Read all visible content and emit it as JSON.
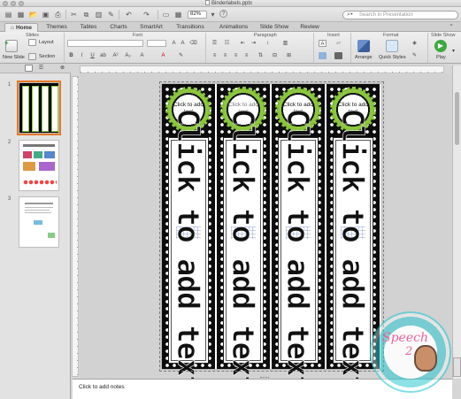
{
  "window": {
    "title": "Binderlabels.pptx"
  },
  "toolbar": {
    "zoom": "82%",
    "search_placeholder": "Search in Presentation"
  },
  "tabs": [
    "Home",
    "Themes",
    "Tables",
    "Charts",
    "SmartArt",
    "Transitions",
    "Animations",
    "Slide Show",
    "Review"
  ],
  "ribbon": {
    "groups": [
      "Slides",
      "Font",
      "Paragraph",
      "Insert",
      "Format",
      "Slide Show"
    ],
    "new_slide": "New Slide",
    "layout": "Layout",
    "section": "Section",
    "arrange": "Arrange",
    "quick_styles": "Quick Styles",
    "play": "Play"
  },
  "slides_pane": {
    "numbers": [
      "1",
      "2",
      "3"
    ],
    "selected": "1"
  },
  "slide": {
    "circle_placeholder": "Click to add text",
    "strip_text": "Click to add text"
  },
  "notes": {
    "placeholder": "Click to add notes"
  },
  "logo": {
    "word": "Speech",
    "number": "2"
  },
  "colors": {
    "accent_green": "#8cc63f",
    "selection_orange": "#e37a2a",
    "logo_teal": "#2ec8d0",
    "logo_pink": "#e8639b"
  }
}
